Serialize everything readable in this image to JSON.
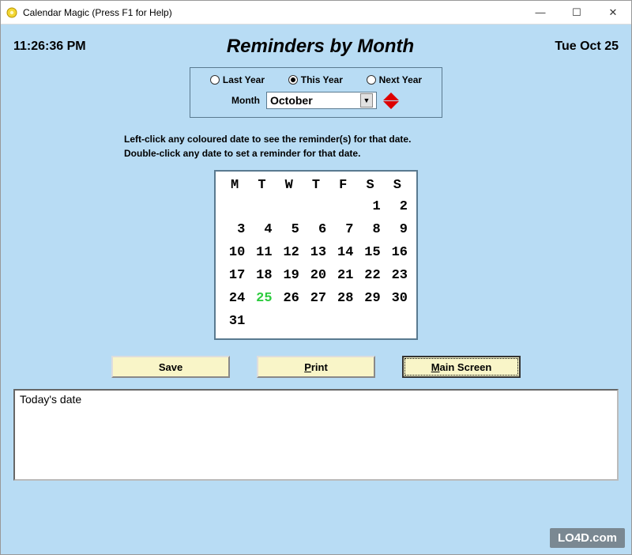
{
  "window": {
    "title": "Calendar Magic (Press F1 for Help)"
  },
  "header": {
    "clock": "11:26:36 PM",
    "title": "Reminders by Month",
    "date": "Tue Oct 25"
  },
  "yearRadios": {
    "last": "Last Year",
    "this": "This Year",
    "next": "Next Year",
    "selected": "this"
  },
  "monthSelect": {
    "label": "Month",
    "value": "October"
  },
  "hint": {
    "line1": "Left-click any coloured date to see the reminder(s) for that date.",
    "line2": "Double-click any date to set a reminder for that date."
  },
  "calendar": {
    "headers": [
      "M",
      "T",
      "W",
      "T",
      "F",
      "S",
      "S"
    ],
    "rows": [
      [
        "",
        "",
        "",
        "",
        "",
        "1",
        "2"
      ],
      [
        "3",
        "4",
        "5",
        "6",
        "7",
        "8",
        "9"
      ],
      [
        "10",
        "11",
        "12",
        "13",
        "14",
        "15",
        "16"
      ],
      [
        "17",
        "18",
        "19",
        "20",
        "21",
        "22",
        "23"
      ],
      [
        "24",
        "25",
        "26",
        "27",
        "28",
        "29",
        "30"
      ],
      [
        "31",
        "",
        "",
        "",
        "",
        "",
        ""
      ]
    ],
    "today": "25"
  },
  "buttons": {
    "save": "Save",
    "print": "Print",
    "main": "Main Screen"
  },
  "reminderText": "Today's date",
  "watermark": "LO4D.com"
}
